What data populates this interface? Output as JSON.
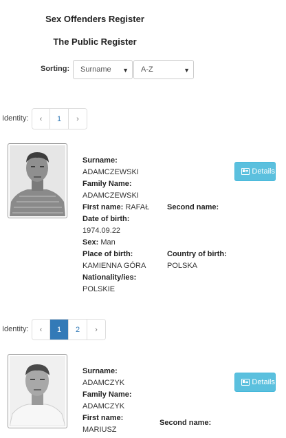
{
  "header": {
    "title": "Sex Offenders Register",
    "subtitle": "The Public Register"
  },
  "sorting": {
    "label": "Sorting:",
    "field_value": "Surname",
    "order_value": "A-Z"
  },
  "labels": {
    "surname": "Surname:",
    "family_name": "Family Name:",
    "first_name": "First name:",
    "second_name": "Second name:",
    "date_of_birth": "Date of birth:",
    "sex": "Sex:",
    "place_of_birth": "Place of birth:",
    "country_of_birth": "Country of birth:",
    "nationality": "Nationality/ies:",
    "details_button": "Details",
    "identity": "Identity:"
  },
  "pager1": {
    "prev": "‹",
    "pages": [
      "1"
    ],
    "next": "›"
  },
  "pager2": {
    "prev": "‹",
    "pages": [
      "1",
      "2"
    ],
    "active": "1",
    "next": "›"
  },
  "records": [
    {
      "surname": "ADAMCZEWSKI",
      "family_name": "ADAMCZEWSKI",
      "first_name": "RAFAŁ",
      "date_of_birth": "1974.09.22",
      "sex": "Man",
      "place_of_birth": "KAMIENNA GÓRA",
      "country_of_birth": "POLSKA",
      "nationality": "POLSKIE"
    },
    {
      "surname": "ADAMCZYK",
      "family_name": "ADAMCZYK",
      "first_name": "MARIUSZ"
    }
  ],
  "colors": {
    "details_button": "#5bc0de",
    "pager_active": "#337ab7"
  }
}
